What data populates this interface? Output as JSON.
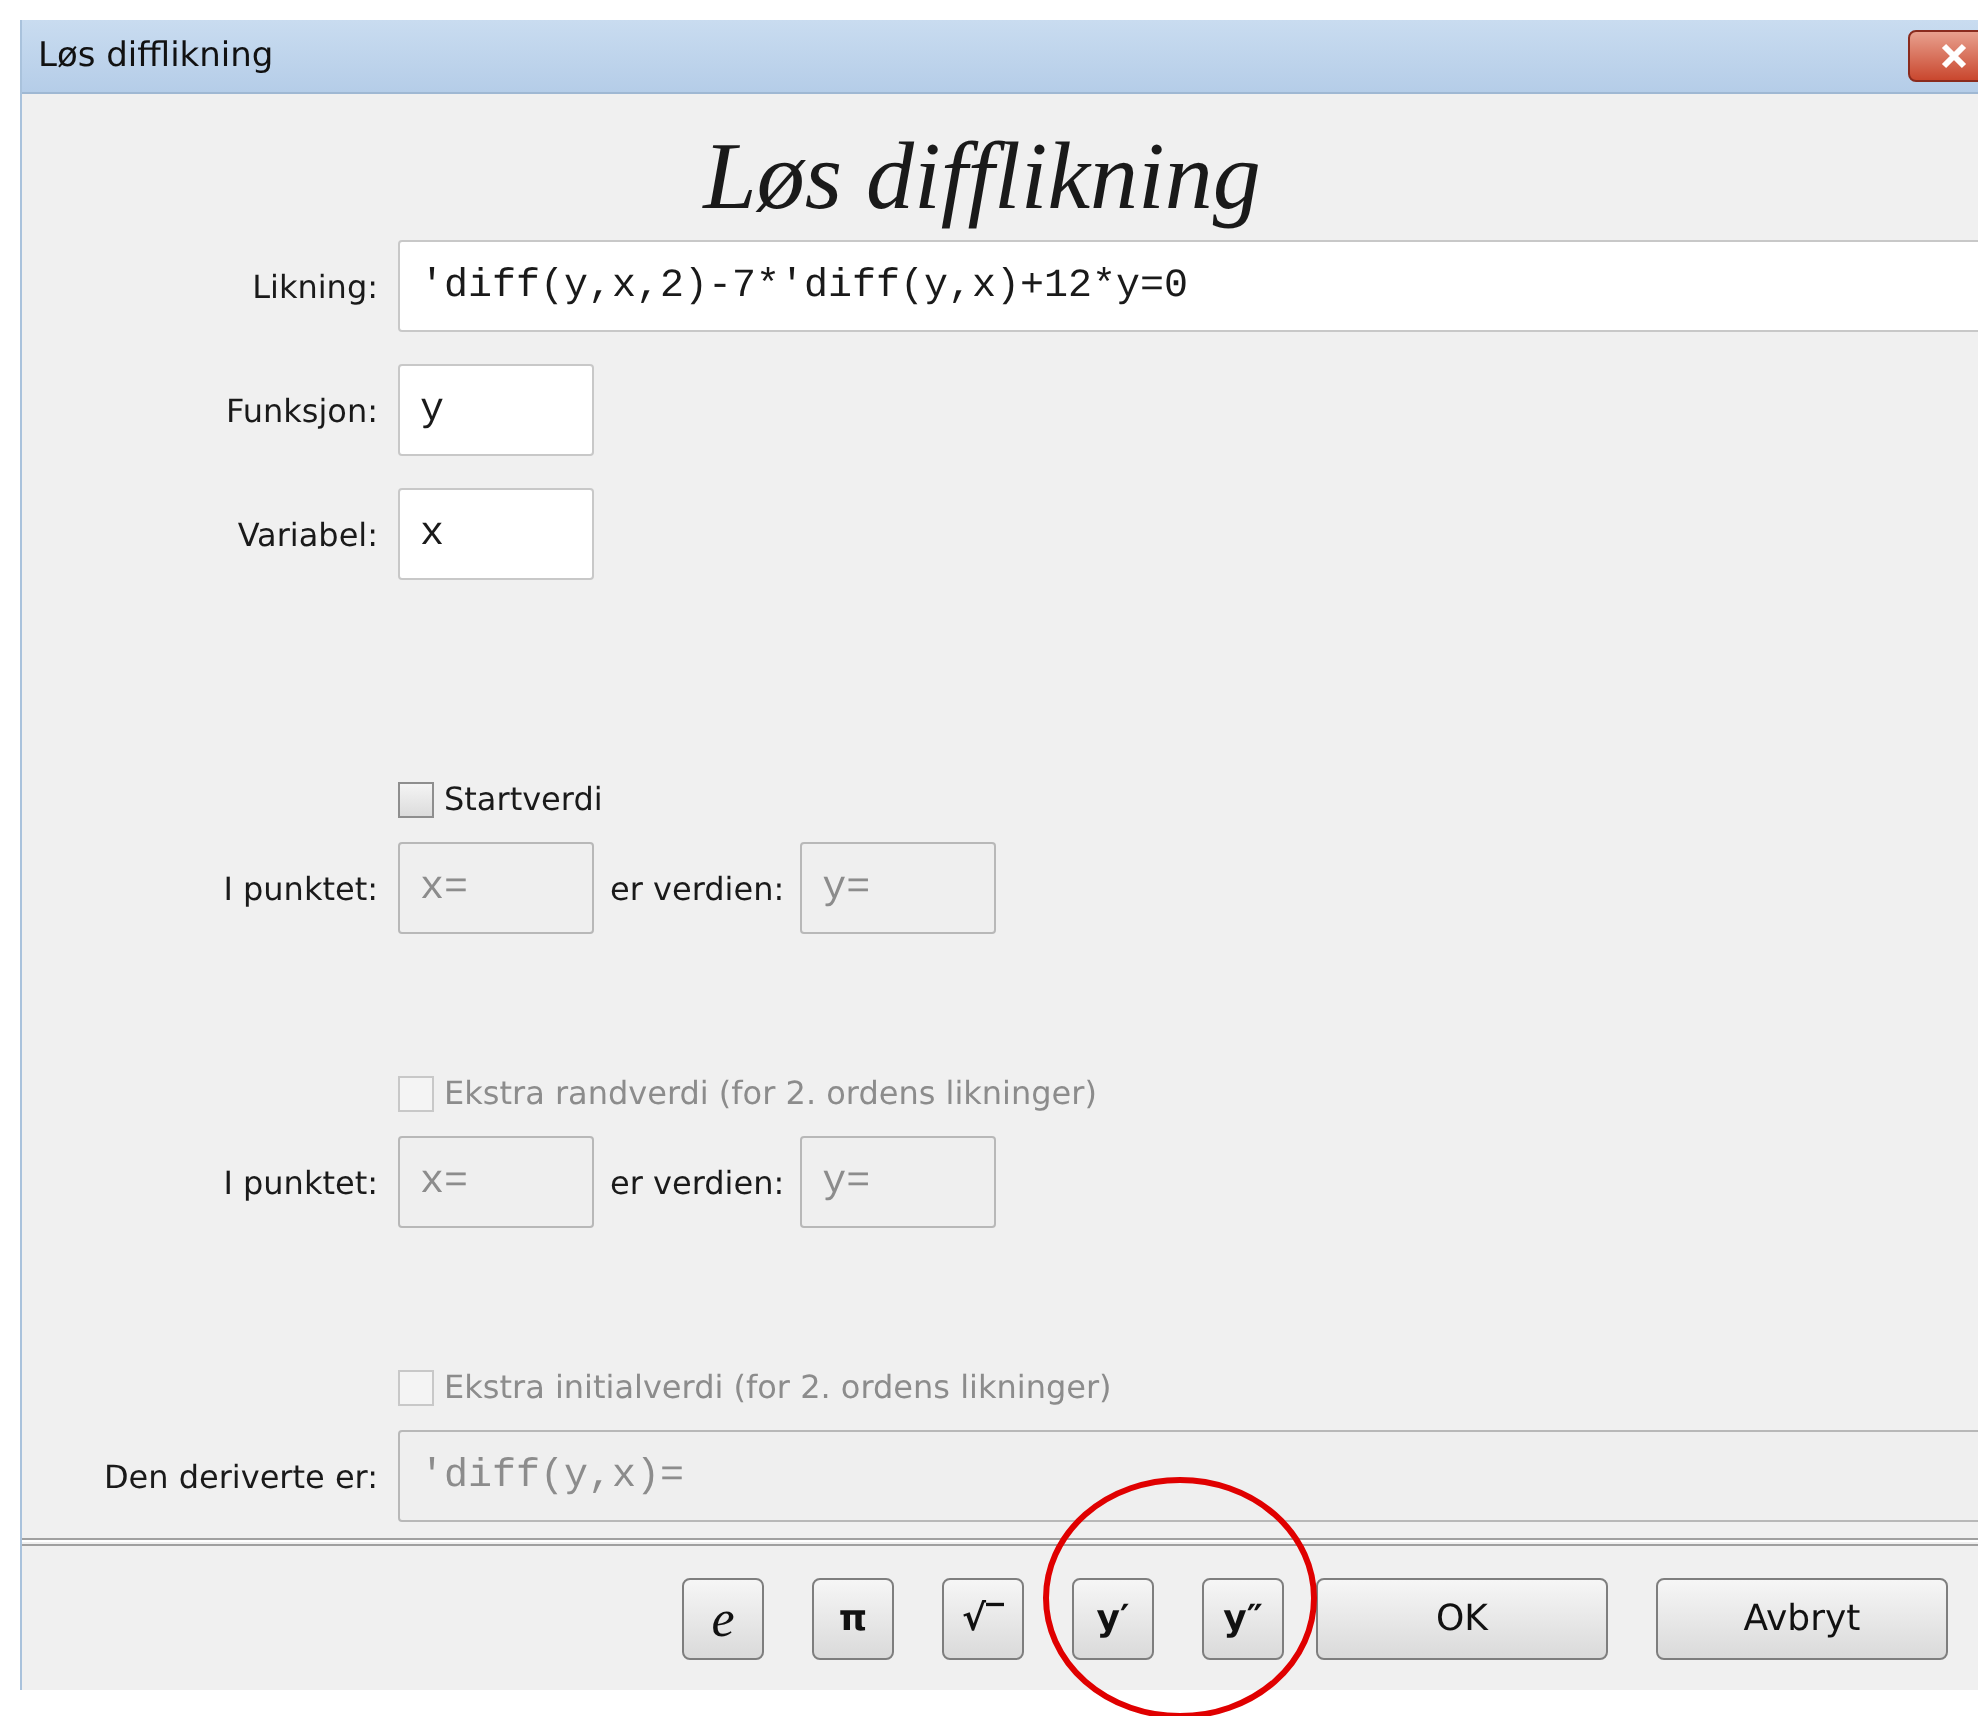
{
  "window": {
    "title": "Løs difflikning"
  },
  "heading": "Løs difflikning",
  "rows": [
    {
      "kind": "longfield",
      "label": "Likning:",
      "value": "'diff(y,x,2)-7*'diff(y,x)+12*y=0",
      "disabled": false
    },
    {
      "kind": "field",
      "label": "Funksjon:",
      "value": "y",
      "disabled": false
    },
    {
      "kind": "field",
      "label": "Variabel:",
      "value": "x",
      "disabled": false
    },
    {
      "kind": "checkbox",
      "label": "Startverdi",
      "checked": false,
      "disabled": false
    },
    {
      "kind": "pair",
      "label": "I punktet:",
      "first": {
        "value": "x=",
        "disabled": true
      },
      "middle": "er verdien:",
      "second": {
        "value": "y=",
        "disabled": true
      }
    },
    {
      "kind": "checkbox",
      "label": "Ekstra randverdi (for 2. ordens likninger)",
      "checked": false,
      "disabled": true
    },
    {
      "kind": "pair",
      "label": "I punktet:",
      "first": {
        "value": "x=",
        "disabled": true
      },
      "middle": "er verdien:",
      "second": {
        "value": "y=",
        "disabled": true
      }
    },
    {
      "kind": "checkbox",
      "label": "Ekstra initialverdi (for 2. ordens likninger)",
      "checked": false,
      "disabled": true
    },
    {
      "kind": "longfield",
      "label": "Den deriverte er:",
      "value": "'diff(y,x)=",
      "disabled": true
    }
  ],
  "buttons": [
    {
      "kind": "symbol",
      "label": "e"
    },
    {
      "kind": "symbol",
      "label": "π"
    },
    {
      "kind": "symbol",
      "label": "√‾"
    },
    {
      "kind": "symbol",
      "label": "y′"
    },
    {
      "kind": "symbol",
      "label": "y″"
    },
    {
      "kind": "action",
      "label": "OK"
    },
    {
      "kind": "action",
      "label": "Avbryt"
    }
  ]
}
